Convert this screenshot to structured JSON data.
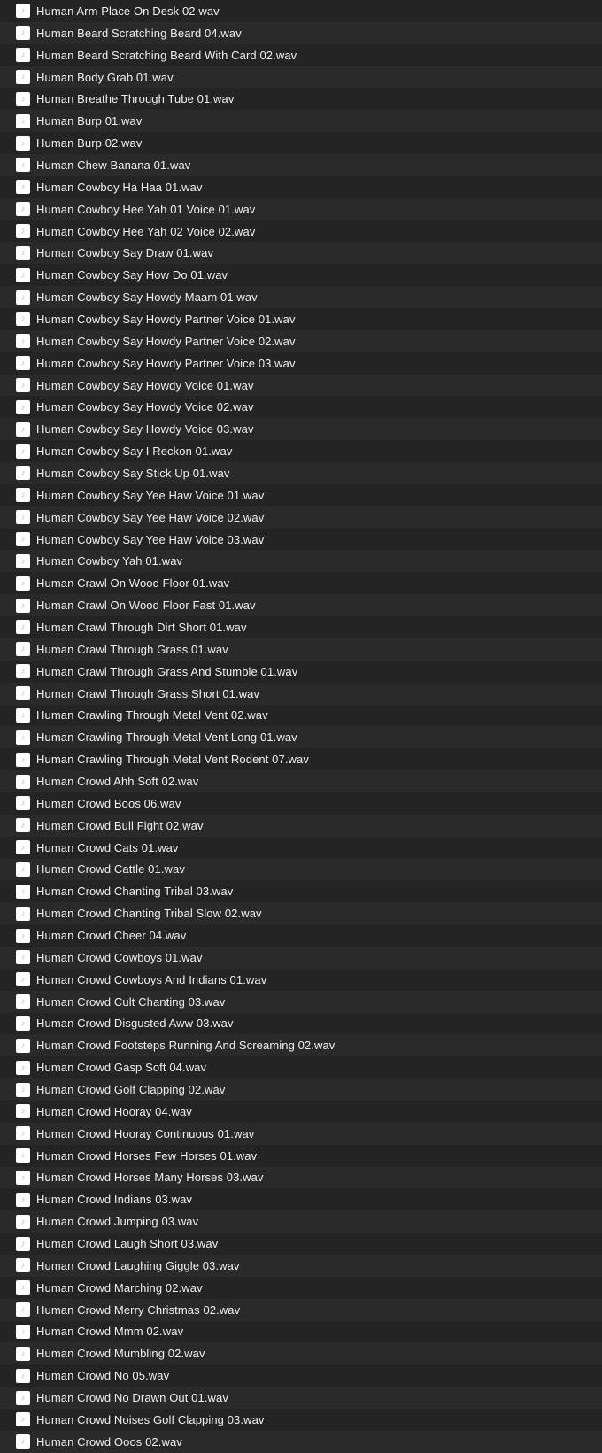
{
  "files": [
    "Human Arm Place On Desk 02.wav",
    "Human Beard Scratching Beard 04.wav",
    "Human Beard Scratching Beard With Card 02.wav",
    "Human Body Grab 01.wav",
    "Human Breathe Through Tube 01.wav",
    "Human Burp 01.wav",
    "Human Burp 02.wav",
    "Human Chew Banana 01.wav",
    "Human Cowboy Ha Haa 01.wav",
    "Human Cowboy Hee Yah 01 Voice 01.wav",
    "Human Cowboy Hee Yah 02 Voice 02.wav",
    "Human Cowboy Say Draw 01.wav",
    "Human Cowboy Say How Do 01.wav",
    "Human Cowboy Say Howdy Maam 01.wav",
    "Human Cowboy Say Howdy Partner Voice 01.wav",
    "Human Cowboy Say Howdy Partner Voice 02.wav",
    "Human Cowboy Say Howdy Partner Voice 03.wav",
    "Human Cowboy Say Howdy Voice 01.wav",
    "Human Cowboy Say Howdy Voice 02.wav",
    "Human Cowboy Say Howdy Voice 03.wav",
    "Human Cowboy Say I Reckon 01.wav",
    "Human Cowboy Say Stick Up 01.wav",
    "Human Cowboy Say Yee Haw Voice 01.wav",
    "Human Cowboy Say Yee Haw Voice 02.wav",
    "Human Cowboy Say Yee Haw Voice 03.wav",
    "Human Cowboy Yah 01.wav",
    "Human Crawl On Wood Floor 01.wav",
    "Human Crawl On Wood Floor Fast 01.wav",
    "Human Crawl Through Dirt Short 01.wav",
    "Human Crawl Through Grass 01.wav",
    "Human Crawl Through Grass And Stumble 01.wav",
    "Human Crawl Through Grass Short 01.wav",
    "Human Crawling Through Metal Vent 02.wav",
    "Human Crawling Through Metal Vent Long 01.wav",
    "Human Crawling Through Metal Vent Rodent 07.wav",
    "Human Crowd Ahh Soft 02.wav",
    "Human Crowd Boos 06.wav",
    "Human Crowd Bull Fight 02.wav",
    "Human Crowd Cats 01.wav",
    "Human Crowd Cattle 01.wav",
    "Human Crowd Chanting Tribal 03.wav",
    "Human Crowd Chanting Tribal Slow 02.wav",
    "Human Crowd Cheer 04.wav",
    "Human Crowd Cowboys 01.wav",
    "Human Crowd Cowboys And Indians 01.wav",
    "Human Crowd Cult Chanting 03.wav",
    "Human Crowd Disgusted Aww 03.wav",
    "Human Crowd Footsteps Running And Screaming 02.wav",
    "Human Crowd Gasp Soft 04.wav",
    "Human Crowd Golf Clapping 02.wav",
    "Human Crowd Hooray 04.wav",
    "Human Crowd Hooray Continuous 01.wav",
    "Human Crowd Horses Few Horses 01.wav",
    "Human Crowd Horses Many Horses 03.wav",
    "Human Crowd Indians 03.wav",
    "Human Crowd Jumping 03.wav",
    "Human Crowd Laugh Short 03.wav",
    "Human Crowd Laughing Giggle 03.wav",
    "Human Crowd Marching 02.wav",
    "Human Crowd Merry Christmas 02.wav",
    "Human Crowd Mmm 02.wav",
    "Human Crowd Mumbling 02.wav",
    "Human Crowd No 05.wav",
    "Human Crowd No Drawn Out 01.wav",
    "Human Crowd Noises Golf Clapping 03.wav",
    "Human Crowd Ooos 02.wav"
  ]
}
